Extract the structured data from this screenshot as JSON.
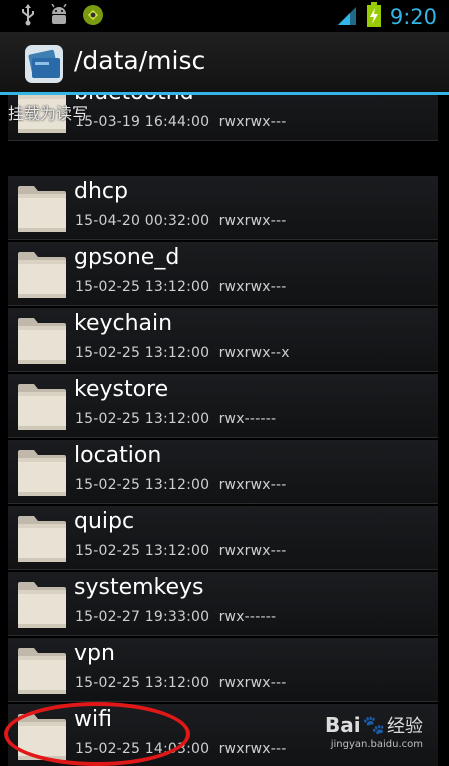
{
  "status_bar": {
    "time": "9:20",
    "colors": {
      "accent": "#33b5e5",
      "battery": "#99cc00"
    }
  },
  "action_bar": {
    "title": "/data/misc"
  },
  "mount_label": "挂载为读写",
  "files": [
    {
      "name": "bluetoothd",
      "date": "15-03-19 16:44:00",
      "perms": "rwxrwx---"
    },
    {
      "name": "dhcp",
      "date": "15-04-20 00:32:00",
      "perms": "rwxrwx---"
    },
    {
      "name": "gpsone_d",
      "date": "15-02-25 13:12:00",
      "perms": "rwxrwx---"
    },
    {
      "name": "keychain",
      "date": "15-02-25 13:12:00",
      "perms": "rwxrwx--x"
    },
    {
      "name": "keystore",
      "date": "15-02-25 13:12:00",
      "perms": "rwx------"
    },
    {
      "name": "location",
      "date": "15-02-25 13:12:00",
      "perms": "rwxrwx---"
    },
    {
      "name": "quipc",
      "date": "15-02-25 13:12:00",
      "perms": "rwxrwx---"
    },
    {
      "name": "systemkeys",
      "date": "15-02-27 19:33:00",
      "perms": "rwx------"
    },
    {
      "name": "vpn",
      "date": "15-02-25 13:12:00",
      "perms": "rwxrwx---"
    },
    {
      "name": "wifi",
      "date": "15-02-25 14:03:00",
      "perms": "rwxrwx---"
    }
  ],
  "watermark": {
    "brand": "Bai",
    "brand2": "经验",
    "url": "jingyan.baidu.com"
  }
}
